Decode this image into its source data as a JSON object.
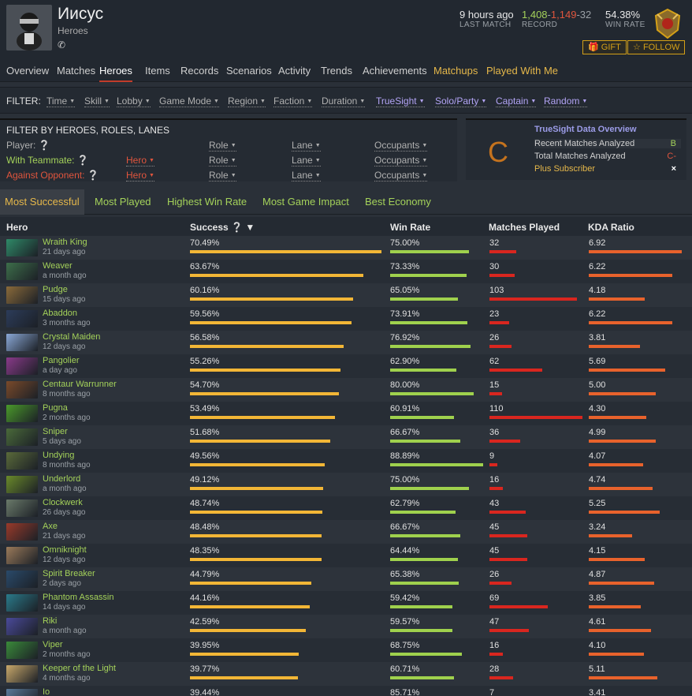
{
  "player": {
    "name": "Иисус",
    "subtitle": "Heroes",
    "phone_icon": "phone-icon"
  },
  "stats": {
    "last_match": {
      "value": "9 hours ago",
      "label": "LAST MATCH"
    },
    "record": {
      "wins": "1,408",
      "sep1": "-",
      "losses": "1,149",
      "sep2": "-",
      "abandons": "32",
      "label": "RECORD"
    },
    "win_rate": {
      "value": "54.38%",
      "label": "WIN RATE"
    }
  },
  "buttons": {
    "gift": "GIFT",
    "follow": "FOLLOW"
  },
  "nav": [
    "Overview",
    "Matches",
    "Heroes",
    "Items",
    "Records",
    "Scenarios",
    "Activity",
    "Trends",
    "Achievements",
    "Matchups",
    "Played With Me"
  ],
  "filter": {
    "label": "FILTER:",
    "items": [
      "Time",
      "Skill",
      "Lobby",
      "Game Mode",
      "Region",
      "Faction",
      "Duration",
      "TrueSight",
      "Solo/Party",
      "Captain",
      "Random"
    ]
  },
  "hero_filter": {
    "title": "FILTER BY HEROES, ROLES, LANES",
    "player_label": "Player:",
    "teammate_label": "With Teammate:",
    "opponent_label": "Against Opponent:",
    "hero": "Hero",
    "role": "Role",
    "lane": "Lane",
    "occupants": "Occupants"
  },
  "truesight": {
    "grade": "C",
    "title": "TrueSight Data Overview",
    "recent_label": "Recent Matches Analyzed",
    "recent_grade": "B",
    "total_label": "Total Matches Analyzed",
    "total_grade": "C-",
    "subscriber": "Plus Subscriber",
    "close": "×"
  },
  "tabs": [
    "Most Successful",
    "Most Played",
    "Highest Win Rate",
    "Most Game Impact",
    "Best Economy"
  ],
  "table": {
    "headers": {
      "hero": "Hero",
      "success": "Success",
      "win_rate": "Win Rate",
      "matches": "Matches Played",
      "kda": "KDA Ratio"
    },
    "rows": [
      {
        "hero": "Wraith King",
        "date": "21 days ago",
        "success": "70.49%",
        "win_rate": "75.00%",
        "matches": "32",
        "kda": "6.92",
        "s": 70.49,
        "w": 75.0,
        "m": 32,
        "k": 6.92,
        "color": "#2f8a68"
      },
      {
        "hero": "Weaver",
        "date": "a month ago",
        "success": "63.67%",
        "win_rate": "73.33%",
        "matches": "30",
        "kda": "6.22",
        "s": 63.67,
        "w": 73.33,
        "m": 30,
        "k": 6.22,
        "color": "#3d6e4a"
      },
      {
        "hero": "Pudge",
        "date": "15 days ago",
        "success": "60.16%",
        "win_rate": "65.05%",
        "matches": "103",
        "kda": "4.18",
        "s": 60.16,
        "w": 65.05,
        "m": 103,
        "k": 4.18,
        "color": "#8a6a3a"
      },
      {
        "hero": "Abaddon",
        "date": "3 months ago",
        "success": "59.56%",
        "win_rate": "73.91%",
        "matches": "23",
        "kda": "6.22",
        "s": 59.56,
        "w": 73.91,
        "m": 23,
        "k": 6.22,
        "color": "#2c3c5a"
      },
      {
        "hero": "Crystal Maiden",
        "date": "12 days ago",
        "success": "56.58%",
        "win_rate": "76.92%",
        "matches": "26",
        "kda": "3.81",
        "s": 56.58,
        "w": 76.92,
        "m": 26,
        "k": 3.81,
        "color": "#8aa8d6"
      },
      {
        "hero": "Pangolier",
        "date": "a day ago",
        "success": "55.26%",
        "win_rate": "62.90%",
        "matches": "62",
        "kda": "5.69",
        "s": 55.26,
        "w": 62.9,
        "m": 62,
        "k": 5.69,
        "color": "#8a3a8a"
      },
      {
        "hero": "Centaur Warrunner",
        "date": "8 months ago",
        "success": "54.70%",
        "win_rate": "80.00%",
        "matches": "15",
        "kda": "5.00",
        "s": 54.7,
        "w": 80.0,
        "m": 15,
        "k": 5.0,
        "color": "#7a4a2a"
      },
      {
        "hero": "Pugna",
        "date": "2 months ago",
        "success": "53.49%",
        "win_rate": "60.91%",
        "matches": "110",
        "kda": "4.30",
        "s": 53.49,
        "w": 60.91,
        "m": 110,
        "k": 4.3,
        "color": "#4a9a2a"
      },
      {
        "hero": "Sniper",
        "date": "5 days ago",
        "success": "51.68%",
        "win_rate": "66.67%",
        "matches": "36",
        "kda": "4.99",
        "s": 51.68,
        "w": 66.67,
        "m": 36,
        "k": 4.99,
        "color": "#4a6a3a"
      },
      {
        "hero": "Undying",
        "date": "8 months ago",
        "success": "49.56%",
        "win_rate": "88.89%",
        "matches": "9",
        "kda": "4.07",
        "s": 49.56,
        "w": 88.89,
        "m": 9,
        "k": 4.07,
        "color": "#5a6a3a"
      },
      {
        "hero": "Underlord",
        "date": "a month ago",
        "success": "49.12%",
        "win_rate": "75.00%",
        "matches": "16",
        "kda": "4.74",
        "s": 49.12,
        "w": 75.0,
        "m": 16,
        "k": 4.74,
        "color": "#6a8a2a"
      },
      {
        "hero": "Clockwerk",
        "date": "26 days ago",
        "success": "48.74%",
        "win_rate": "62.79%",
        "matches": "43",
        "kda": "5.25",
        "s": 48.74,
        "w": 62.79,
        "m": 43,
        "k": 5.25,
        "color": "#6a7a6a"
      },
      {
        "hero": "Axe",
        "date": "21 days ago",
        "success": "48.48%",
        "win_rate": "66.67%",
        "matches": "45",
        "kda": "3.24",
        "s": 48.48,
        "w": 66.67,
        "m": 45,
        "k": 3.24,
        "color": "#9a3a2a"
      },
      {
        "hero": "Omniknight",
        "date": "12 days ago",
        "success": "48.35%",
        "win_rate": "64.44%",
        "matches": "45",
        "kda": "4.15",
        "s": 48.35,
        "w": 64.44,
        "m": 45,
        "k": 4.15,
        "color": "#9a7a5a"
      },
      {
        "hero": "Spirit Breaker",
        "date": "2 days ago",
        "success": "44.79%",
        "win_rate": "65.38%",
        "matches": "26",
        "kda": "4.87",
        "s": 44.79,
        "w": 65.38,
        "m": 26,
        "k": 4.87,
        "color": "#2a4a6a"
      },
      {
        "hero": "Phantom Assassin",
        "date": "14 days ago",
        "success": "44.16%",
        "win_rate": "59.42%",
        "matches": "69",
        "kda": "3.85",
        "s": 44.16,
        "w": 59.42,
        "m": 69,
        "k": 3.85,
        "color": "#2a7a8a"
      },
      {
        "hero": "Riki",
        "date": "a month ago",
        "success": "42.59%",
        "win_rate": "59.57%",
        "matches": "47",
        "kda": "4.61",
        "s": 42.59,
        "w": 59.57,
        "m": 47,
        "k": 4.61,
        "color": "#4a4a9a"
      },
      {
        "hero": "Viper",
        "date": "2 months ago",
        "success": "39.95%",
        "win_rate": "68.75%",
        "matches": "16",
        "kda": "4.10",
        "s": 39.95,
        "w": 68.75,
        "m": 16,
        "k": 4.1,
        "color": "#3a8a3a"
      },
      {
        "hero": "Keeper of the Light",
        "date": "4 months ago",
        "success": "39.77%",
        "win_rate": "60.71%",
        "matches": "28",
        "kda": "5.11",
        "s": 39.77,
        "w": 60.71,
        "m": 28,
        "k": 5.11,
        "color": "#c8a86a"
      },
      {
        "hero": "Io",
        "date": "",
        "success": "39.44%",
        "win_rate": "85.71%",
        "matches": "7",
        "kda": "3.41",
        "s": 39.44,
        "w": 85.71,
        "m": 7,
        "k": 3.41,
        "color": "#5a7a9a"
      }
    ]
  }
}
